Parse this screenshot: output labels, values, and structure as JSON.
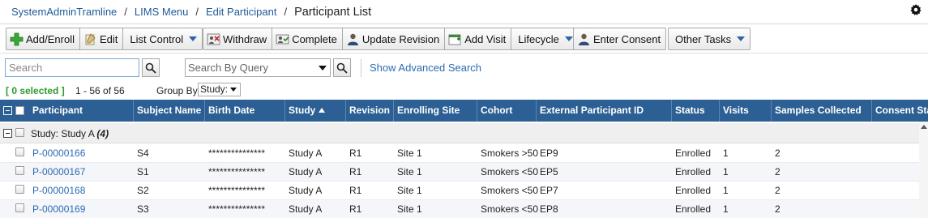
{
  "breadcrumb": {
    "items": [
      "SystemAdminTramline",
      "LIMS Menu",
      "Edit Participant"
    ],
    "separator": "/",
    "current": "Participant List"
  },
  "toolbar": {
    "add_enroll": "Add/Enroll",
    "edit": "Edit",
    "list_control": "List Control",
    "withdraw": "Withdraw",
    "complete": "Complete",
    "update_revision": "Update Revision",
    "add_visit": "Add Visit",
    "lifecycle": "Lifecycle",
    "enter_consent": "Enter Consent",
    "other_tasks": "Other Tasks"
  },
  "search": {
    "placeholder": "Search",
    "query_placeholder": "Search By Query",
    "advanced_link": "Show Advanced Search"
  },
  "status": {
    "selected": "[ 0 selected ]",
    "range": "1 - 56 of 56",
    "group_by_label": "Group By",
    "group_by_value": "Study:"
  },
  "grid": {
    "columns": [
      "Participant",
      "Subject Name",
      "Birth Date",
      "Study",
      "Revision",
      "Enrolling Site",
      "Cohort",
      "External Participant ID",
      "Status",
      "Visits",
      "Samples Collected",
      "Consent Sta"
    ],
    "sorted_column": "Study",
    "sort_direction": "ascending",
    "group": {
      "label": "Study: Study A",
      "count": "(4)"
    },
    "rows": [
      {
        "participant": "P-00000166",
        "subject": "S4",
        "birth": "***************",
        "study": "Study A",
        "revision": "R1",
        "site": "Site 1",
        "cohort": "Smokers >50",
        "ext_id": "EP9",
        "status": "Enrolled",
        "visits": "1",
        "samples": "2",
        "consent": ""
      },
      {
        "participant": "P-00000167",
        "subject": "S1",
        "birth": "***************",
        "study": "Study A",
        "revision": "R1",
        "site": "Site 1",
        "cohort": "Smokers <50",
        "ext_id": "EP5",
        "status": "Enrolled",
        "visits": "1",
        "samples": "2",
        "consent": ""
      },
      {
        "participant": "P-00000168",
        "subject": "S2",
        "birth": "***************",
        "study": "Study A",
        "revision": "R1",
        "site": "Site 1",
        "cohort": "Smokers <50",
        "ext_id": "EP7",
        "status": "Enrolled",
        "visits": "1",
        "samples": "2",
        "consent": ""
      },
      {
        "participant": "P-00000169",
        "subject": "S3",
        "birth": "***************",
        "study": "Study A",
        "revision": "R1",
        "site": "Site 1",
        "cohort": "Smokers <50",
        "ext_id": "EP8",
        "status": "Enrolled",
        "visits": "1",
        "samples": "2",
        "consent": ""
      }
    ]
  },
  "colors": {
    "header_bg": "#2c5f94",
    "link": "#2d6bb3",
    "selected_text": "#2e9b2e",
    "caret": "#2e63a8"
  }
}
